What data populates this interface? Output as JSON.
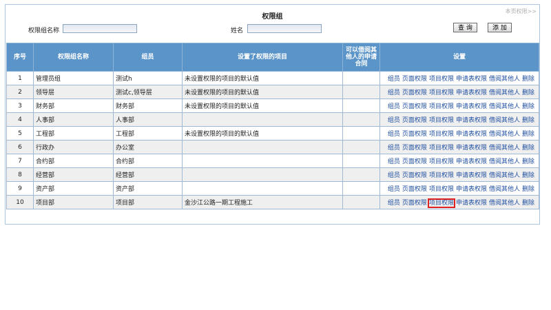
{
  "header": {
    "title": "权限组",
    "page_perm_link": "本页权限>>"
  },
  "search": {
    "group_name_label": "权限组名称",
    "group_name_value": "",
    "name_label": "姓名",
    "name_value": "",
    "query_button": "查 询",
    "add_button": "添 加"
  },
  "table": {
    "columns": [
      "序号",
      "权限组名称",
      "组员",
      "设置了权限的项目",
      "可以借阅其他人的申请合同",
      "设置"
    ],
    "ops": [
      "组员",
      "页面权限",
      "项目权限",
      "申请表权限",
      "借阅其他人",
      "删除"
    ],
    "rows": [
      {
        "no": "1",
        "name": "管理员组",
        "members": "测试h",
        "projects": "未设置权限的项目的默认值",
        "borrow": ""
      },
      {
        "no": "2",
        "name": "领导层",
        "members": "测试c,领导层",
        "projects": "未设置权限的项目的默认值",
        "borrow": ""
      },
      {
        "no": "3",
        "name": "财务部",
        "members": "财务部",
        "projects": "未设置权限的项目的默认值",
        "borrow": ""
      },
      {
        "no": "4",
        "name": "人事部",
        "members": "人事部",
        "projects": "",
        "borrow": ""
      },
      {
        "no": "5",
        "name": "工程部",
        "members": "工程部",
        "projects": "未设置权限的项目的默认值",
        "borrow": ""
      },
      {
        "no": "6",
        "name": "行政办",
        "members": "办公室",
        "projects": "",
        "borrow": ""
      },
      {
        "no": "7",
        "name": "合约部",
        "members": "合约部",
        "projects": "",
        "borrow": ""
      },
      {
        "no": "8",
        "name": "经营部",
        "members": "经营部",
        "projects": "",
        "borrow": ""
      },
      {
        "no": "9",
        "name": "资产部",
        "members": "资产部",
        "projects": "",
        "borrow": ""
      },
      {
        "no": "10",
        "name": "项目部",
        "members": "项目部",
        "projects": "金沙江公路一期工程施工",
        "borrow": ""
      }
    ]
  },
  "highlight": {
    "row": 9,
    "op": 2,
    "color": "#e02020"
  }
}
